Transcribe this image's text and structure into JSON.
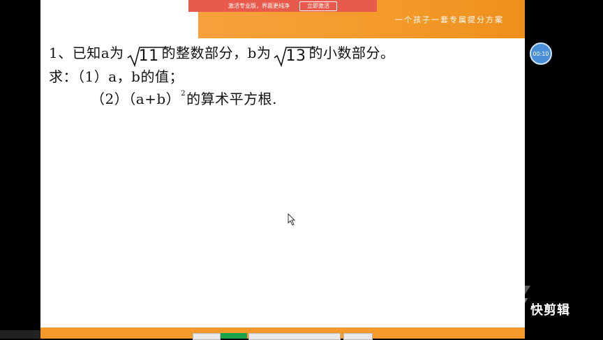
{
  "promo": {
    "message": "激活专业版，界面更纯净",
    "button": "立即激活"
  },
  "banner": {
    "slogan": "一个孩子一套专属提分方案"
  },
  "problem": {
    "line1_a": "1、已知a为",
    "line1_rad1": "11",
    "line1_b": "的整数部分，b为",
    "line1_rad2": "13",
    "line1_c": "的小数部分。",
    "line2": "求：（1）a，b的值；",
    "line3_a": "（2）（a+b）",
    "line3_sup": "2",
    "line3_b": "的算术平方根."
  },
  "recorder": {
    "timer": "00:10"
  },
  "watermark": {
    "text": "快剪辑"
  },
  "colors": {
    "accent_orange": "#f39a2a",
    "promo_red": "#e85b4c",
    "timer_blue": "#4a90d9"
  }
}
